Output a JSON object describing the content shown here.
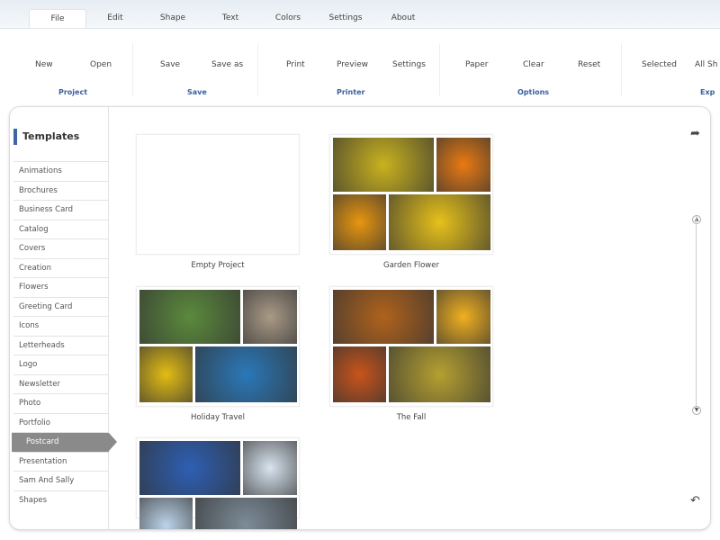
{
  "tabs": [
    "File",
    "Edit",
    "Shape",
    "Text",
    "Colors",
    "Settings",
    "About"
  ],
  "active_tab": "File",
  "ribbon": {
    "buttons": [
      "New",
      "Open",
      "Save",
      "Save as",
      "Print",
      "Preview",
      "Settings",
      "Paper",
      "Clear",
      "Reset",
      "Selected",
      "All Sh"
    ],
    "groups": [
      "Project",
      "Save",
      "Printer",
      "Options",
      "Exp"
    ]
  },
  "sidebar": {
    "title": "Templates",
    "items": [
      "Animations",
      "Brochures",
      "Business Card",
      "Catalog",
      "Covers",
      "Creation",
      "Flowers",
      "Greeting Card",
      "Icons",
      "Letterheads",
      "Logo",
      "Newsletter",
      "Photo",
      "Portfolio",
      "Postcard",
      "Presentation",
      "Sam And Sally",
      "Shapes"
    ],
    "selected": "Postcard"
  },
  "templates": [
    {
      "name": "Empty Project",
      "colors": []
    },
    {
      "name": "Garden Flower",
      "colors": [
        "#c9b21e",
        "#e97a12",
        "#e8960f",
        "#e6c11a"
      ]
    },
    {
      "name": "Holiday Travel",
      "colors": [
        "#5b8a3c",
        "#a99a86",
        "#e3bd14",
        "#2a78b9"
      ]
    },
    {
      "name": "The Fall",
      "colors": [
        "#b0621c",
        "#f0b020",
        "#c9541a",
        "#b5a030"
      ]
    },
    {
      "name": "",
      "colors": [
        "#2d5fb4",
        "#d8e4ef",
        "#bcd4ea",
        "#7d8c99"
      ]
    }
  ],
  "icons": {
    "share": "share-arrow-icon",
    "undo": "undo-arrow-icon",
    "scroll_up": "chevron-up-icon",
    "scroll_down": "chevron-down-icon"
  }
}
